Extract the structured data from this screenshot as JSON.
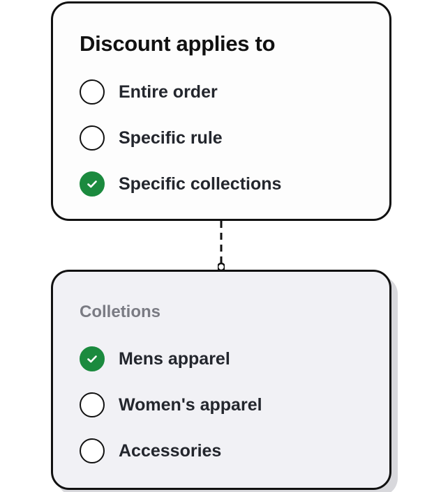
{
  "discount": {
    "title": "Discount applies to",
    "options": [
      {
        "label": "Entire order",
        "selected": false
      },
      {
        "label": "Specific rule",
        "selected": false
      },
      {
        "label": "Specific collections",
        "selected": true
      }
    ]
  },
  "collections": {
    "title": "Colletions",
    "options": [
      {
        "label": "Mens apparel",
        "selected": true
      },
      {
        "label": "Women's apparel",
        "selected": false
      },
      {
        "label": "Accessories",
        "selected": false
      }
    ]
  },
  "colors": {
    "selected": "#1b8a3e",
    "border": "#111111",
    "text": "#23262d",
    "muted": "#7a7b83",
    "panel": "#f1f1f5"
  },
  "icons": {
    "unselected": "radio-empty-icon",
    "selected": "check-circle-icon",
    "connector": "dashed-connector"
  }
}
